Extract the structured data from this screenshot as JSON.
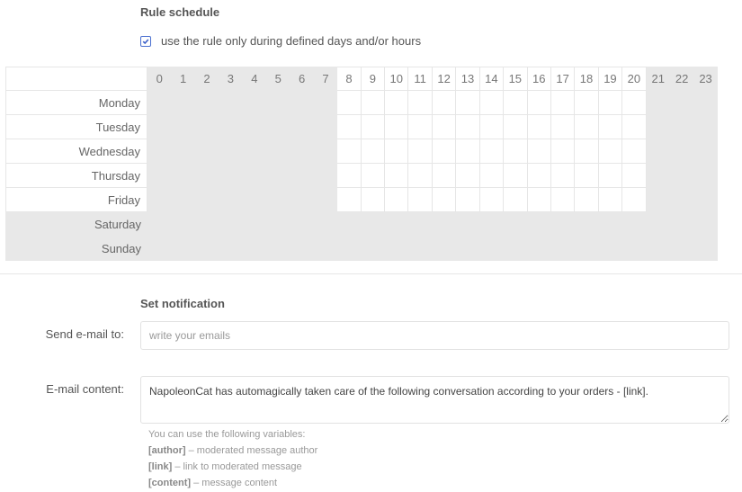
{
  "schedule": {
    "title": "Rule schedule",
    "checkbox": {
      "label": "use the rule only during defined days and/or hours",
      "checked": true
    },
    "hours": [
      "0",
      "1",
      "2",
      "3",
      "4",
      "5",
      "6",
      "7",
      "8",
      "9",
      "10",
      "11",
      "12",
      "13",
      "14",
      "15",
      "16",
      "17",
      "18",
      "19",
      "20",
      "21",
      "22",
      "23"
    ],
    "days": [
      {
        "label": "Monday",
        "active_hours": [
          8,
          9,
          10,
          11,
          12,
          13,
          14,
          15,
          16,
          17,
          18,
          19,
          20
        ]
      },
      {
        "label": "Tuesday",
        "active_hours": [
          8,
          9,
          10,
          11,
          12,
          13,
          14,
          15,
          16,
          17,
          18,
          19,
          20
        ]
      },
      {
        "label": "Wednesday",
        "active_hours": [
          8,
          9,
          10,
          11,
          12,
          13,
          14,
          15,
          16,
          17,
          18,
          19,
          20
        ]
      },
      {
        "label": "Thursday",
        "active_hours": [
          8,
          9,
          10,
          11,
          12,
          13,
          14,
          15,
          16,
          17,
          18,
          19,
          20
        ]
      },
      {
        "label": "Friday",
        "active_hours": [
          8,
          9,
          10,
          11,
          12,
          13,
          14,
          15,
          16,
          17,
          18,
          19,
          20
        ]
      },
      {
        "label": "Saturday",
        "active_hours": []
      },
      {
        "label": "Sunday",
        "active_hours": []
      }
    ],
    "colors": {
      "inactive": "#e8e8e8",
      "active": "#ffffff",
      "checkbox_accent": "#4a6fd0"
    }
  },
  "notification": {
    "title": "Set notification",
    "email_label": "Send e-mail to:",
    "email_placeholder": "write your emails",
    "email_value": "",
    "content_label": "E-mail content:",
    "content_value": "NapoleonCat has automagically taken care of the following conversation according to your orders - [link].",
    "help_intro": "You can use the following variables:",
    "variables": [
      {
        "name": "[author]",
        "desc": " – moderated message author"
      },
      {
        "name": "[link]",
        "desc": " – link to moderated message"
      },
      {
        "name": "[content]",
        "desc": " – message content"
      }
    ]
  }
}
